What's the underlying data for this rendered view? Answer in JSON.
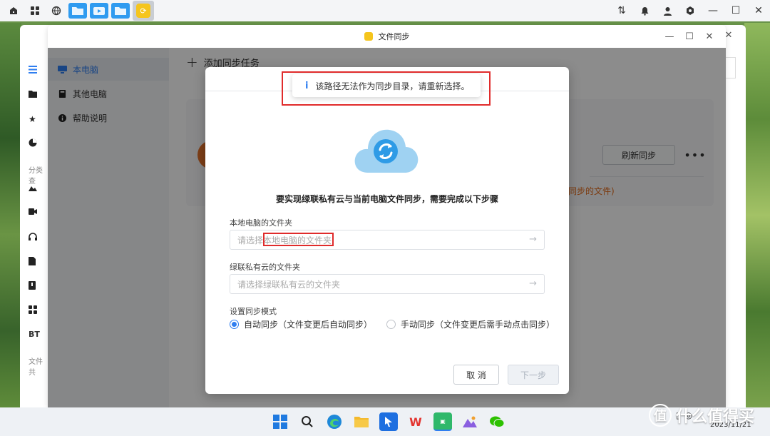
{
  "app_window": {
    "title": "文件同步"
  },
  "sidebar": {
    "items": [
      {
        "label": "本电脑",
        "active": true
      },
      {
        "label": "其他电脑",
        "active": false
      },
      {
        "label": "帮助说明",
        "active": false
      }
    ]
  },
  "main": {
    "add_task_label": "添加同步任务",
    "refresh_label": "刷新同步",
    "more_label": "•••",
    "card_hint": "同步的文件)"
  },
  "back_window": {
    "section_label_1": "分类查",
    "section_label_2": "文件共",
    "bt_label": "BT"
  },
  "toast": {
    "message": "该路径无法作为同步目录，请重新选择。"
  },
  "dialog": {
    "heading": "要实现绿联私有云与当前电脑文件同步，需要完成以下步骤",
    "local_folder_label": "本地电脑的文件夹",
    "local_folder_placeholder": "请选择本地电脑的文件夹",
    "cloud_folder_label": "绿联私有云的文件夹",
    "cloud_folder_placeholder": "请选择绿联私有云的文件夹",
    "sync_mode_label": "设置同步模式",
    "auto_sync_label": "自动同步（文件变更后自动同步）",
    "manual_sync_label": "手动同步（文件变更后需手动点击同步）",
    "cancel_label": "取 消",
    "next_label": "下一步"
  },
  "taskbar": {
    "clock_date": "2023/11/21"
  },
  "watermark": {
    "text": "什么值得买"
  },
  "colors": {
    "accent": "#2f7ef0",
    "sync_icon": "#f5c51d",
    "annotation_red": "#e02b2b"
  }
}
